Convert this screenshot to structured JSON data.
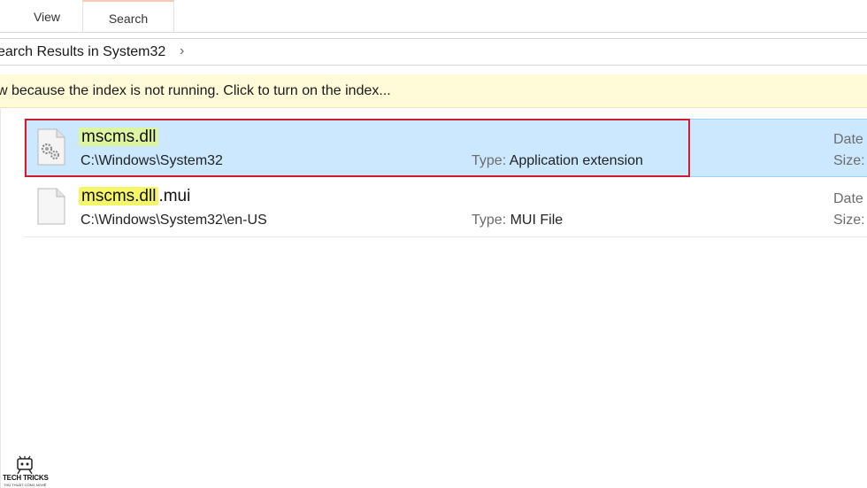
{
  "ribbon": {
    "tabs": [
      {
        "label": "View"
      },
      {
        "label": "Search",
        "active": true
      }
    ]
  },
  "address": {
    "breadcrumb": "earch Results in System32",
    "chevron": "›"
  },
  "infobar": {
    "text": "w because the index is not running.  Click to turn on the index..."
  },
  "results": [
    {
      "name_match": "mscms.dll",
      "name_rest": "",
      "path": "C:\\Windows\\System32",
      "type_label": "Type:",
      "type_value": "Application extension",
      "date_label": "Date",
      "size_label": "Size:",
      "icon": "dll-settings-file-icon",
      "selected": true
    },
    {
      "name_match": "mscms.dll",
      "name_rest": ".mui",
      "path": "C:\\Windows\\System32\\en-US",
      "type_label": "Type:",
      "type_value": "MUI File",
      "date_label": "Date",
      "size_label": "Size:",
      "icon": "blank-file-icon",
      "selected": false
    }
  ],
  "watermark": {
    "title": "TECH TRICKS",
    "subtitle": "THỦ THUẬT CÔNG NGHỆ",
    "icon": "tech-tricks-logo-icon"
  },
  "colors": {
    "selection_bg": "#cce8ff",
    "selection_outline": "#cc1e2e",
    "highlight": "#f5f56a",
    "infobar_bg": "#fffbd9"
  }
}
